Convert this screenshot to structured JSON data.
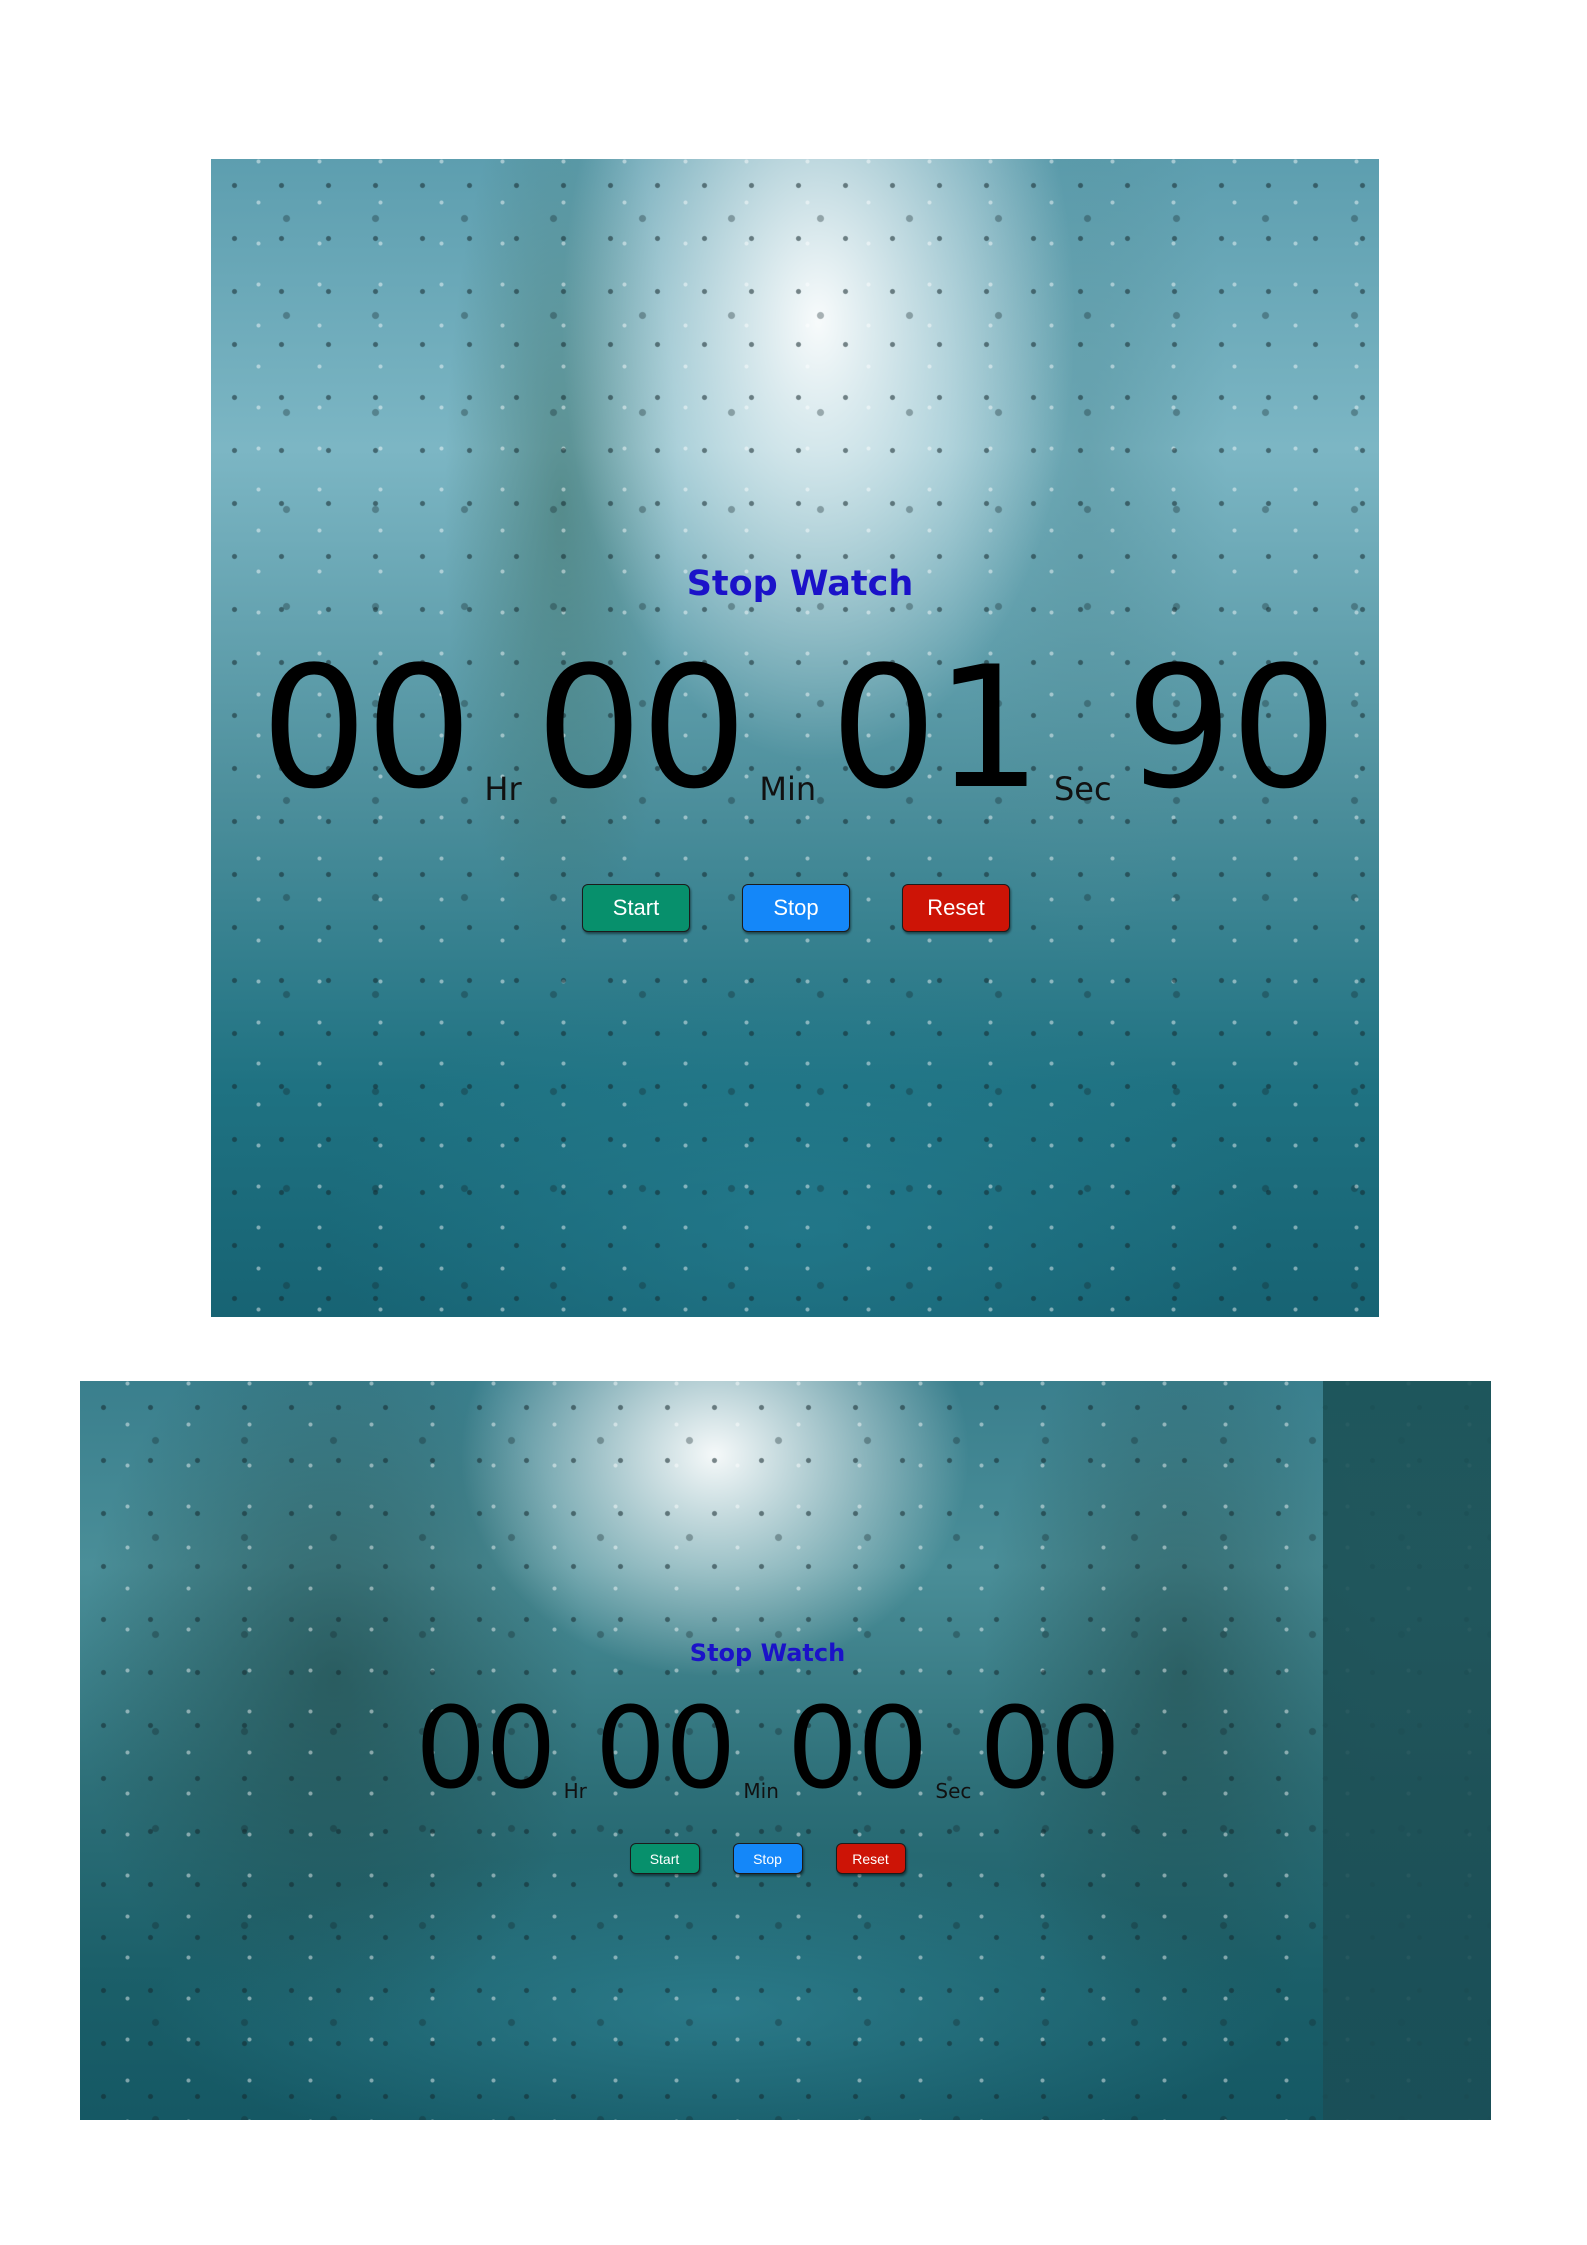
{
  "screens": [
    {
      "title": "Stop Watch",
      "time": {
        "hours": "00",
        "minutes": "00",
        "seconds": "01",
        "centiseconds": "90"
      },
      "units": {
        "hours": "Hr",
        "minutes": "Min",
        "seconds": "Sec"
      },
      "buttons": {
        "start": "Start",
        "stop": "Stop",
        "reset": "Reset"
      }
    },
    {
      "title": "Stop Watch",
      "time": {
        "hours": "00",
        "minutes": "00",
        "seconds": "00",
        "centiseconds": "00"
      },
      "units": {
        "hours": "Hr",
        "minutes": "Min",
        "seconds": "Sec"
      },
      "buttons": {
        "start": "Start",
        "stop": "Stop",
        "reset": "Reset"
      }
    }
  ],
  "colors": {
    "title": "#1b12c9",
    "start_button": "#07906c",
    "stop_button": "#1487f9",
    "reset_button": "#cd1406"
  }
}
